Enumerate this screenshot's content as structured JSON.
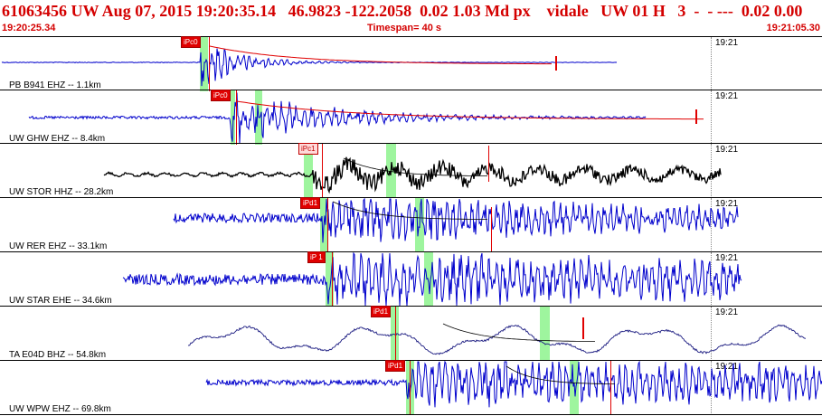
{
  "header": {
    "title": "61063456 UW Aug 07, 2015 19:20:35.14   46.9823 -122.2058  0.02 1.03 Md px    vidale   UW 01 H   3  -  - ---  0.02 0.00",
    "start_time": "19:20:25.34",
    "timespan": "Timespan=  40 s",
    "end_time": "19:21:05.30"
  },
  "colors": {
    "header_red": "#d40000",
    "trace_blue": "#0000cc",
    "trace_black": "#000000",
    "pick_red": "#e00000",
    "window_green": "#9ef59e"
  },
  "time_label": "19:21",
  "panels": [
    {
      "label": "PB B941 EHZ -- 1.1km",
      "pick": "iPc0",
      "pick_style": "red",
      "color": "blue"
    },
    {
      "label": "UW GHW EHZ -- 8.4km",
      "pick": "iPc0",
      "pick_style": "red",
      "color": "blue"
    },
    {
      "label": "UW STOR HHZ -- 28.2km",
      "pick": "iPc1",
      "pick_style": "light",
      "color": "black"
    },
    {
      "label": "UW RER EHZ -- 33.1km",
      "pick": "iPd1",
      "pick_style": "red",
      "color": "blue"
    },
    {
      "label": "UW STAR EHE -- 34.6km",
      "pick": "iP 1",
      "pick_style": "red",
      "color": "blue"
    },
    {
      "label": "TA E04D BHZ -- 54.8km",
      "pick": "iPd1",
      "pick_style": "red",
      "color": "navy"
    },
    {
      "label": "UW WPW EHZ -- 69.8km",
      "pick": "iPd1",
      "pick_style": "red",
      "color": "blue"
    }
  ]
}
